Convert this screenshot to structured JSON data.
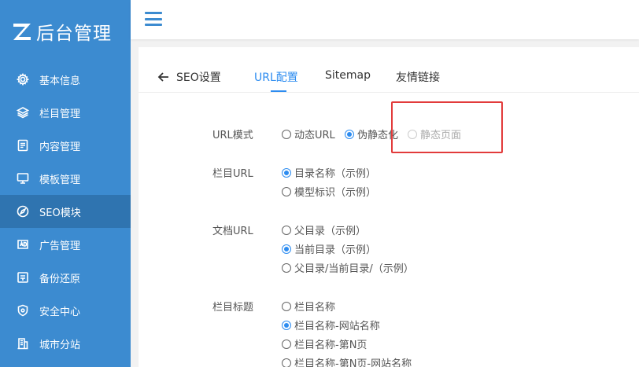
{
  "brand": {
    "title": "后台管理"
  },
  "sidebar": {
    "items": [
      {
        "label": "基本信息",
        "icon": "gear-icon"
      },
      {
        "label": "栏目管理",
        "icon": "layers-icon"
      },
      {
        "label": "内容管理",
        "icon": "document-icon"
      },
      {
        "label": "模板管理",
        "icon": "monitor-icon"
      },
      {
        "label": "SEO模块",
        "icon": "compass-icon"
      },
      {
        "label": "广告管理",
        "icon": "ad-icon"
      },
      {
        "label": "备份还原",
        "icon": "backup-icon"
      },
      {
        "label": "安全中心",
        "icon": "shield-icon"
      },
      {
        "label": "城市分站",
        "icon": "building-icon"
      }
    ]
  },
  "tabs": {
    "back_label": "SEO设置",
    "items": [
      {
        "label": "URL配置"
      },
      {
        "label": "Sitemap"
      },
      {
        "label": "友情链接"
      }
    ]
  },
  "form": {
    "url_mode": {
      "label": "URL模式",
      "options": [
        "动态URL",
        "伪静态化",
        "静态页面"
      ]
    },
    "column_url": {
      "label": "栏目URL",
      "options": [
        "目录名称（示例）",
        "模型标识（示例）"
      ]
    },
    "doc_url": {
      "label": "文档URL",
      "options": [
        "父目录（示例）",
        "当前目录（示例）",
        "父目录/当前目录/（示例）"
      ]
    },
    "column_title": {
      "label": "栏目标题",
      "options": [
        "栏目名称",
        "栏目名称-网站名称",
        "栏目名称-第N页",
        "栏目名称-第N页-网站名称"
      ]
    }
  },
  "colors": {
    "sidebar": "#3c8bd0",
    "accent": "#2d8cf0",
    "highlight": "#e23b3b"
  }
}
